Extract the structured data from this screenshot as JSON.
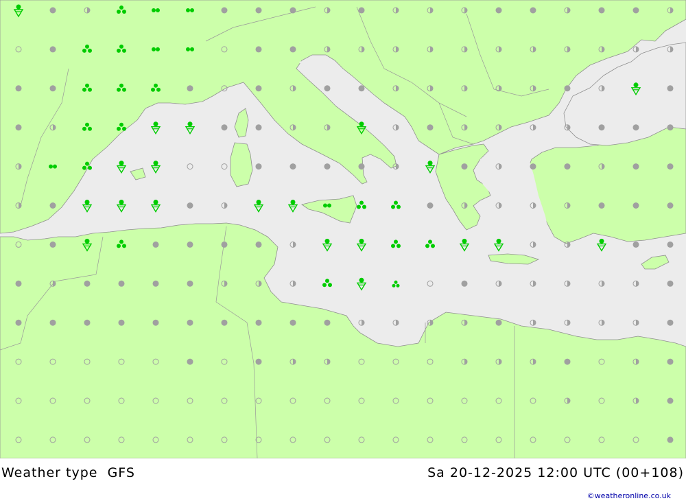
{
  "map": {
    "colors": {
      "sea": "#ececec",
      "land": "#ccffaa",
      "border": "#999999",
      "dot": "#a0a0a0",
      "precip": "#00cc00"
    },
    "grid": {
      "cols": 20,
      "rows": 12,
      "legend": "o=clear, h=partly cloudy, c=overcast, v=showers, s=rain, p=drizzle, a=heavy rain",
      "cells": [
        "vchappccchchhhcchcch",
        "ocaappocchhhhhhhhhhh",
        "ccaaacochcchhhhhchvc",
        "chaavvcchhvhchhhhccc",
        "hpavvoocccchvchcchcc",
        "hcvvvchvvpaachhhhccc",
        "ocvacccchvvaavvhhvcc",
        "chcccchhhaviochhhhhc",
        "cccccccccchhhhchhhhc",
        "ooooocochhooohhhcohc",
        "oooooooooooooooohohc",
        "oooooooooooooooooooc"
      ]
    }
  },
  "footer": {
    "title": "Weather type",
    "model": "GFS",
    "datetime": "Sa 20-12-2025 12:00 UTC (00+108)"
  },
  "credit": "©weatheronline.co.uk"
}
